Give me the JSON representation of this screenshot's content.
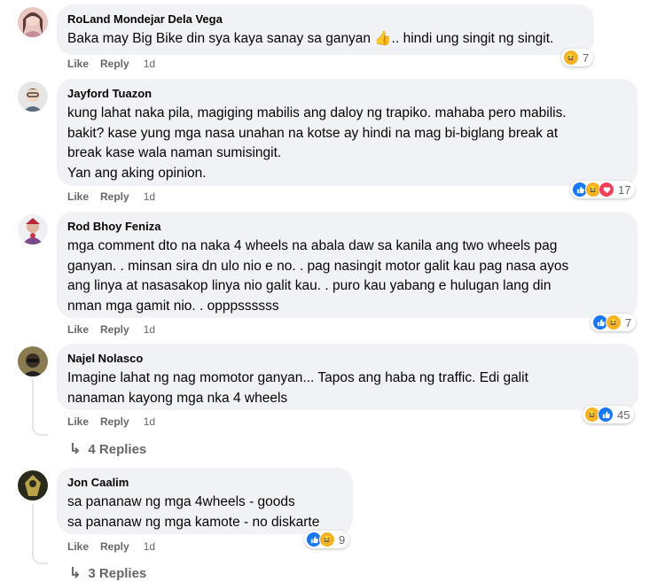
{
  "comments": [
    {
      "author": "RoLand Mondejar Dela Vega",
      "text": "Baka may Big Bike din sya kaya sanay sa ganyan 👍.. hindi ung singit ng singit.",
      "like": "Like",
      "reply": "Reply",
      "time": "1d",
      "reactions": [
        "haha"
      ],
      "reaction_count": "7"
    },
    {
      "author": "Jayford Tuazon",
      "text": "kung lahat naka pila, magiging mabilis ang daloy ng trapiko. mahaba pero mabilis.\nbakit? kase yung mga nasa unahan na kotse ay hindi na mag bi-biglang break at\nbreak kase wala naman sumisingit.\nYan ang aking opinion.",
      "like": "Like",
      "reply": "Reply",
      "time": "1d",
      "reactions": [
        "like",
        "haha",
        "love"
      ],
      "reaction_count": "17"
    },
    {
      "author": "Rod Bhoy Feniza",
      "text": "mga comment dto na naka 4 wheels na abala daw sa kanila ang two wheels pag\nganyan. . minsan sira dn ulo nio e no. . pag nasingit motor galit kau pag nasa ayos\nang linya at nasasakop linya nio galit kau. . puro kau yabang e hulugan lang din\nnman mga gamit nio. . opppssssss",
      "like": "Like",
      "reply": "Reply",
      "time": "1d",
      "reactions": [
        "like",
        "haha"
      ],
      "reaction_count": "7"
    },
    {
      "author": "Najel Nolasco",
      "text": "Imagine lahat ng nag momotor ganyan... Tapos ang haba ng traffic. Edi galit\nnanaman kayong mga nka 4 wheels",
      "like": "Like",
      "reply": "Reply",
      "time": "1d",
      "reactions": [
        "haha",
        "like"
      ],
      "reaction_count": "45",
      "replies_label": "4 Replies"
    },
    {
      "author": "Jon Caalim",
      "text": "sa pananaw ng mga 4wheels - goods\nsa pananaw ng mga kamote - no diskarte",
      "like": "Like",
      "reply": "Reply",
      "time": "1d",
      "reactions": [
        "like",
        "haha"
      ],
      "reaction_count": "9",
      "replies_label": "3 Replies"
    }
  ],
  "icons": {
    "reply_arrow": "reply-arrow-icon",
    "like": "like-reaction-icon",
    "haha": "haha-reaction-icon",
    "love": "love-reaction-icon"
  },
  "colors": {
    "bubble": "#f0f2f5",
    "meta_text": "#65676b",
    "like_blue": "#1877f2",
    "haha_yellow": "#f7b125",
    "love_red": "#f33e58"
  }
}
